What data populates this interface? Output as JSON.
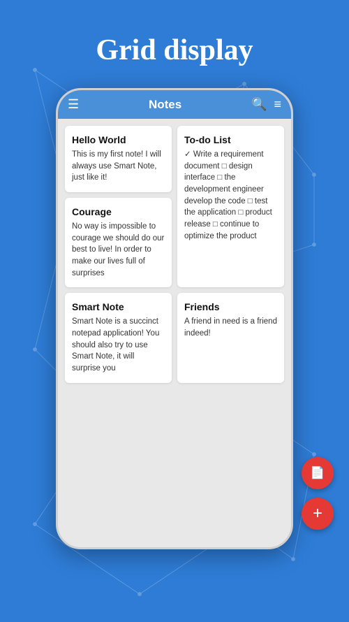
{
  "page": {
    "title": "Grid display",
    "background_color": "#2e7cd6"
  },
  "toolbar": {
    "title": "Notes",
    "menu_icon": "☰",
    "search_icon": "🔍",
    "filter_icon": "≡"
  },
  "notes": [
    {
      "id": "hello-world",
      "title": "Hello World",
      "body": "This is my first note!\nI will always use Smart Note, just like it!"
    },
    {
      "id": "to-do-list",
      "title": "To-do List",
      "body": "✓ Write a requirement document\n□ design interface\n□ the development engineer develop the code\n□ test the application\n□ product release\n□ continue to optimize the product"
    },
    {
      "id": "courage",
      "title": "Courage",
      "body": "No way is impossible to courage\nwe should do our best to live!\nIn order to make our lives full of surprises"
    },
    {
      "id": "friends",
      "title": "Friends",
      "body": "A friend in need is a friend indeed!"
    },
    {
      "id": "smart-note",
      "title": "Smart Note",
      "body": "Smart Note is a succinct notepad application!\nYou should also try to use Smart Note, it will surprise you"
    }
  ],
  "fabs": {
    "document_icon": "📄",
    "add_icon": "+"
  }
}
